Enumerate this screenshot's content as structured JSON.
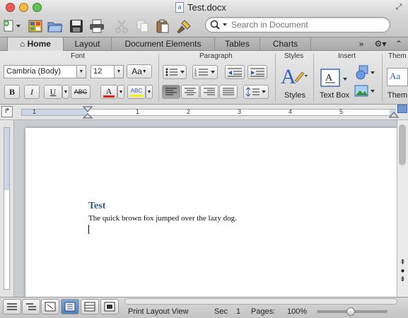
{
  "window": {
    "title": "Test.docx",
    "doc_icon_letter": "a"
  },
  "search": {
    "placeholder": "Search in Document"
  },
  "tabs": [
    {
      "label": "Home"
    },
    {
      "label": "Layout"
    },
    {
      "label": "Document Elements"
    },
    {
      "label": "Tables"
    },
    {
      "label": "Charts"
    }
  ],
  "ribbon": {
    "groups": {
      "font": "Font",
      "paragraph": "Paragraph",
      "styles": "Styles",
      "insert": "Insert",
      "themes": "Them"
    },
    "font_name": "Cambria (Body)",
    "font_size": "12",
    "grow_label": "Aa",
    "bold": "B",
    "italic": "I",
    "underline": "U",
    "strike": "ABC",
    "highlight": "ABC",
    "font_color": "A",
    "styles_label": "Styles",
    "textbox_label": "Text Box",
    "themes_label": "Them",
    "themes_preview": "Aa"
  },
  "ruler": {
    "labels": [
      "1",
      "1",
      "2",
      "3",
      "4",
      "5"
    ]
  },
  "document": {
    "heading": "Test",
    "body": "The quick brown fox jumped over the lazy dog."
  },
  "status": {
    "view": "Print Layout View",
    "sec_label": "Sec",
    "sec_value": "1",
    "pages_label": "Pages:",
    "zoom": "100%"
  },
  "colors": {
    "heading": "#345a8a",
    "font_color_bar": "#e0201b",
    "highlight_bar": "#f2f200",
    "active_view": "#4f7fbd"
  }
}
